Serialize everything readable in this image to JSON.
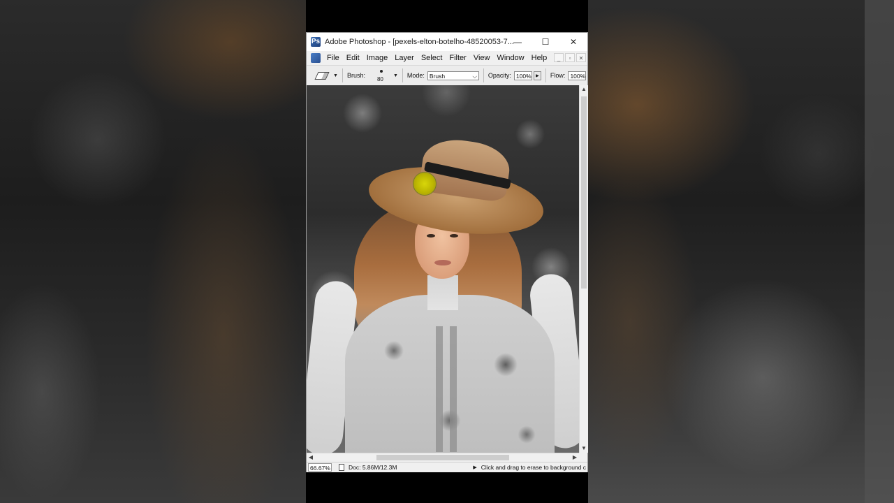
{
  "window": {
    "title": "Adobe Photoshop - [pexels-elton-botelho-48520053-7...",
    "controls": {
      "minimize": "—",
      "maximize": "☐",
      "close": "✕"
    }
  },
  "menu": {
    "items": [
      "File",
      "Edit",
      "Image",
      "Layer",
      "Select",
      "Filter",
      "View",
      "Window",
      "Help"
    ],
    "mdi": {
      "minimize": "_",
      "restore": "▫",
      "close": "✕"
    }
  },
  "options": {
    "brush_label": "Brush:",
    "brush_size": "80",
    "mode_label": "Mode:",
    "mode_value": "Brush",
    "opacity_label": "Opacity:",
    "opacity_value": "100%",
    "flow_label": "Flow:",
    "flow_value": "100%"
  },
  "status": {
    "zoom": "66.67%",
    "doc": "Doc: 5.86M/12.3M",
    "hint": "Click and drag to erase to background c"
  },
  "icons": {
    "app": "photoshop-icon",
    "tool": "eraser-icon",
    "cursor": "brush-cursor-icon"
  },
  "colors": {
    "cursor": "#c9c400",
    "window_bg": "#f0f0f0"
  }
}
